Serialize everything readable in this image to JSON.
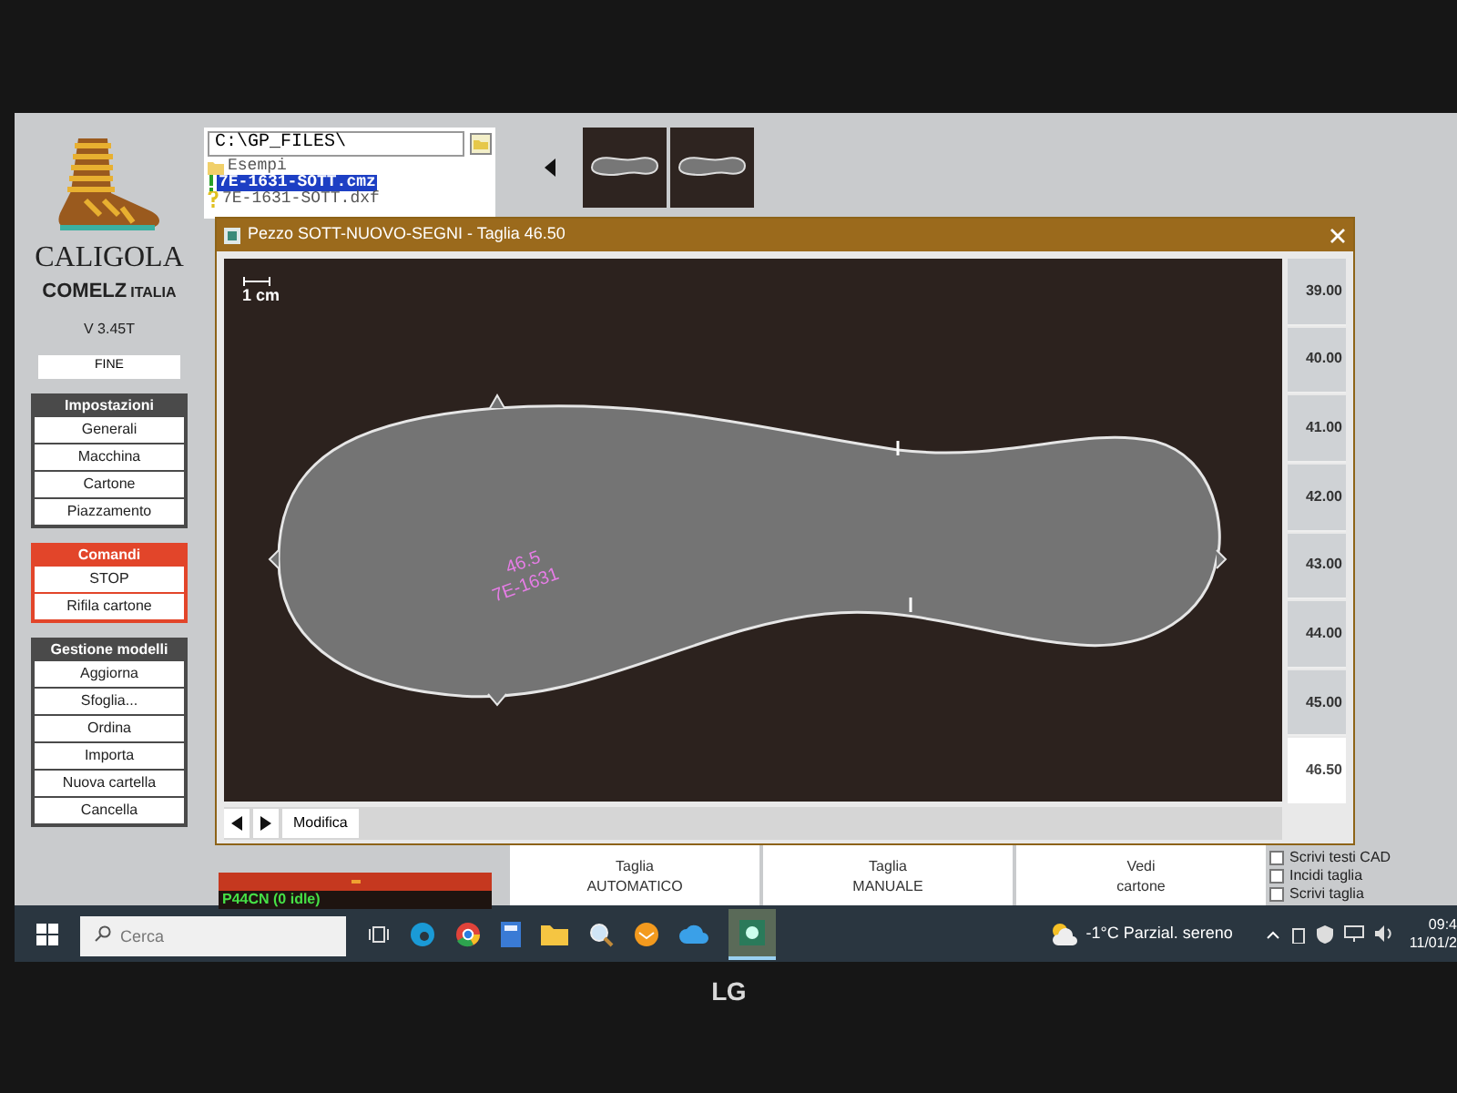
{
  "logo": {
    "name": "CALIGOLA",
    "brand": "COMELZ",
    "country": "ITALIA",
    "version": "V 3.45T"
  },
  "fine_button": "FINE",
  "groups": [
    {
      "title": "Impostazioni",
      "color": "#4a4a4a",
      "buttons": [
        "Generali",
        "Macchina",
        "Cartone",
        "Piazzamento"
      ]
    },
    {
      "title": "Comandi",
      "color": "#e2452a",
      "buttons": [
        "STOP",
        "Rifila cartone"
      ]
    },
    {
      "title": "Gestione modelli",
      "color": "#4a4a4a",
      "buttons": [
        "Aggiorna",
        "Sfoglia...",
        "Ordina",
        "Importa",
        "Nuova cartella",
        "Cancella"
      ]
    }
  ],
  "file_browser": {
    "path": "C:\\GP_FILES\\",
    "items": [
      {
        "name": "Esempi",
        "kind": "folder",
        "selected": false
      },
      {
        "name": "7E-1631-SOTT.cmz",
        "kind": "ok",
        "selected": true
      },
      {
        "name": "7E-1631-SOTT.dxf",
        "kind": "unknown",
        "selected": false
      }
    ]
  },
  "dialog": {
    "title": "Pezzo SOTT-NUOVO-SEGNI - Taglia 46.50",
    "scale_label": "1 cm",
    "piece_labels": [
      "46.5",
      "7E-1631"
    ],
    "sizes": [
      {
        "label": "39.00",
        "selected": false
      },
      {
        "label": "40.00",
        "selected": false
      },
      {
        "label": "41.00",
        "selected": false
      },
      {
        "label": "42.00",
        "selected": false
      },
      {
        "label": "43.00",
        "selected": false
      },
      {
        "label": "44.00",
        "selected": false
      },
      {
        "label": "45.00",
        "selected": false
      },
      {
        "label": "46.50",
        "selected": true
      }
    ],
    "edit_button": "Modifica"
  },
  "status": "P44CN (0 idle)",
  "actions": [
    {
      "lines": [
        "Taglia",
        "AUTOMATICO"
      ]
    },
    {
      "lines": [
        "Taglia",
        "MANUALE"
      ]
    },
    {
      "lines": [
        "Vedi",
        "cartone"
      ]
    }
  ],
  "options": [
    {
      "label": "Scrivi testi CAD",
      "checked": false
    },
    {
      "label": "Incidi taglia",
      "checked": false
    },
    {
      "label": "Scrivi taglia",
      "checked": false
    }
  ],
  "taskbar": {
    "search_placeholder": "Cerca",
    "weather": "-1°C Parzial. sereno",
    "time": "09:4",
    "date": "11/01/2"
  },
  "monitor": {
    "brand": "LG"
  }
}
